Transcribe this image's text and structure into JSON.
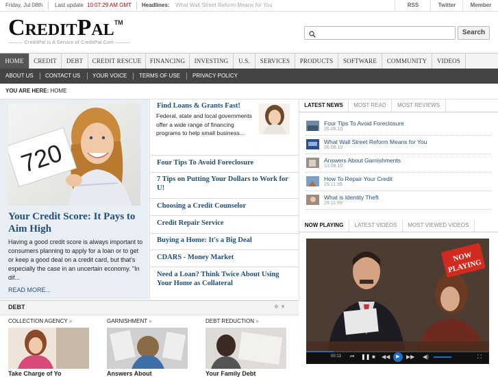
{
  "topbar": {
    "date": "Friday, Jul 08th",
    "last_update_label": "Last update",
    "time": "10:07:29 AM GMT",
    "headlines_label": "Headlines:",
    "ticker": "What Wall Street Reform Means for You",
    "links": [
      "RSS",
      "Twitter",
      "Member"
    ]
  },
  "header": {
    "logo_name": "CreditPal",
    "logo_tm": "TM",
    "tagline": "CreditPal Is A Service of CreditPal.Com",
    "search_placeholder": "",
    "search_button": "Search"
  },
  "nav": {
    "main": [
      "HOME",
      "CREDIT",
      "DEBT",
      "CREDIT RESCUE",
      "FINANCING",
      "INVESTING",
      "U.S.",
      "SERVICES",
      "PRODUCTS",
      "SOFTWARE",
      "COMMUNITY",
      "VIDEOS"
    ],
    "sub": [
      "ABOUT US",
      "CONTACT US",
      "YOUR VOICE",
      "TERMS OF USE",
      "PRIVACY POLICY"
    ]
  },
  "breadcrumb": {
    "label": "YOU ARE HERE:",
    "current": "HOME"
  },
  "feature": {
    "image_text": "720",
    "title": "Your Credit Score: It Pays to Aim High",
    "body": "Having a good credit score is always important to consumers planning to apply for a loan or to get or keep a good deal on a credit card, but that's especially the case in an uncertain economy. \"In dif...",
    "read_more": "READ MORE..."
  },
  "middle": {
    "loans_title": "Find Loans & Grants Fast!",
    "loans_body": "Federal, state and local governments offer a wide range of financing programs to help small business...",
    "links": [
      "Four Tips To Avoid Foreclosure",
      "7 Tips on Putting Your Dollars to Work for U!",
      "Choosing a Credit Counselor",
      "Credit Repair Service",
      "Buying a Home: It's a Big Deal",
      "CDARS - Money Market",
      "Need a Loan? Think Twice About Using Your Home as Collateral"
    ]
  },
  "news_tabs": [
    "LATEST NEWS",
    "MOST READ",
    "MOST REVIEWS"
  ],
  "news": [
    {
      "title": "Four Tips To Avoid Foreclosure",
      "date": "26.08.10"
    },
    {
      "title": "What Wall Street Reform Means for You",
      "date": "26.08.10"
    },
    {
      "title": "Answers About Garnishments",
      "date": "13.08.10"
    },
    {
      "title": "How To Repair Your Credit",
      "date": "29.11.99"
    },
    {
      "title": "What is Identity Theft",
      "date": "29.11.99"
    }
  ],
  "video_tabs": [
    "NOW PLAYING",
    "LATEST VIDEOS",
    "MOST VIEWED VIDEOS"
  ],
  "video": {
    "badge_line1": "NOW",
    "badge_line2": "PLAYING",
    "time": "00:13"
  },
  "debt": {
    "title": "DEBT",
    "categories": [
      {
        "label": "COLLECTION AGENCY",
        "caption": "Take Charge of Yo"
      },
      {
        "label": "GARNISHMENT",
        "caption": "Answers About"
      },
      {
        "label": "DEBT REDUCTION",
        "caption": "Your Family Debt"
      }
    ]
  },
  "colors": {
    "link_blue": "#1f4e79",
    "nav_active": "#555555",
    "subnav_bg": "#444444",
    "time_red": "#cc0000"
  }
}
